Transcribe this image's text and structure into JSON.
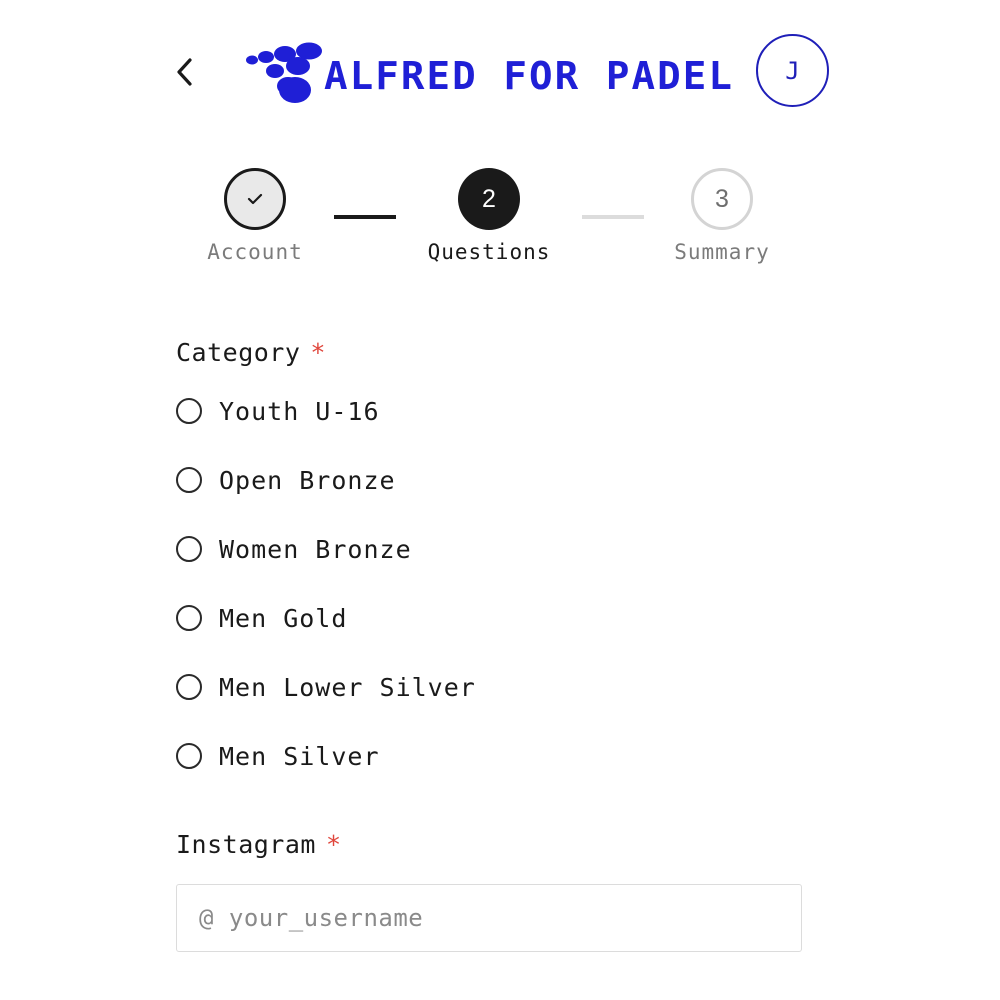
{
  "header": {
    "back_icon": "chevron-left-icon",
    "logo_text": "ALFRED FOR PADEL",
    "brand_color": "#1f1fd6",
    "avatar_initial": "J"
  },
  "stepper": {
    "steps": [
      {
        "number": "1",
        "label": "Account",
        "status": "completed",
        "icon": "check-icon"
      },
      {
        "number": "2",
        "label": "Questions",
        "status": "active"
      },
      {
        "number": "3",
        "label": "Summary",
        "status": "upcoming"
      }
    ]
  },
  "form": {
    "category": {
      "label": "Category",
      "required_mark": "*",
      "options": [
        "Youth U-16",
        "Open Bronze",
        "Women Bronze",
        "Men Gold",
        "Men Lower Silver",
        "Men Silver"
      ],
      "selected": null
    },
    "instagram": {
      "label": "Instagram",
      "required_mark": "*",
      "value": "",
      "placeholder": "@ your_username"
    }
  }
}
